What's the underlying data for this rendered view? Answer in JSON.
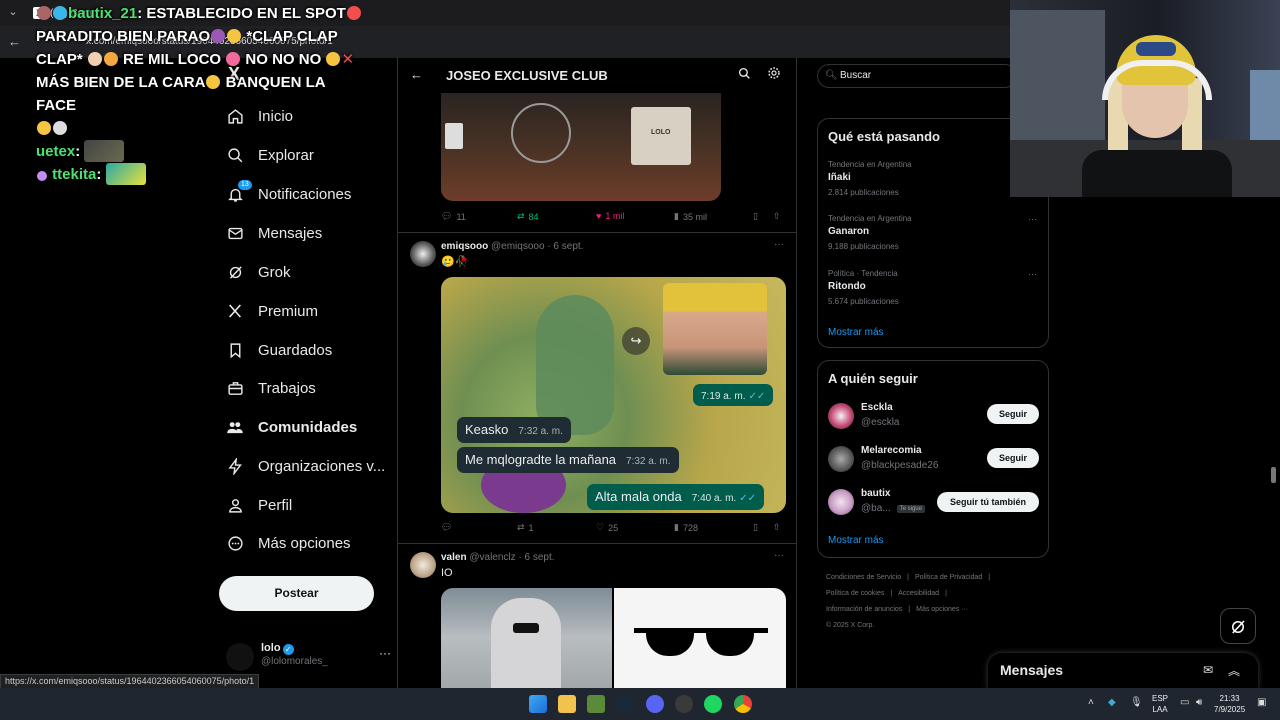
{
  "browser": {
    "tab_title": "(13) Com",
    "url": "x.com/emiqsooo/status/1964402366054060075/photo/1",
    "status_url": "https://x.com/emiqsooo/status/1964402366054060075/photo/1"
  },
  "chat": {
    "messages": [
      {
        "user": "bautix_21",
        "text": ": ESTABLECIDO EN EL SPOT"
      },
      {
        "user": "",
        "text": "PARADITO BIEN PARAO"
      },
      {
        "user": "",
        "text": "*CLAP CLAP"
      },
      {
        "user": "",
        "text": "CLAP*"
      },
      {
        "user": "",
        "text": "RE MIL LOCO"
      },
      {
        "user": "",
        "text": "NO NO NO"
      },
      {
        "user": "",
        "text": "MÁS BIEN DE LA CARA"
      },
      {
        "user": "",
        "text": "BANQUEN LA FACE"
      },
      {
        "user": "uetex",
        "text": ":"
      },
      {
        "user": "ttekita",
        "text": ":"
      }
    ]
  },
  "sidebar": {
    "logo": "X",
    "items": [
      {
        "label": "Inicio",
        "icon": "home-icon"
      },
      {
        "label": "Explorar",
        "icon": "search-icon"
      },
      {
        "label": "Notificaciones",
        "icon": "bell-icon",
        "badge": "13"
      },
      {
        "label": "Mensajes",
        "icon": "mail-icon"
      },
      {
        "label": "Grok",
        "icon": "grok-icon"
      },
      {
        "label": "Premium",
        "icon": "x-logo-icon"
      },
      {
        "label": "Guardados",
        "icon": "bookmark-icon"
      },
      {
        "label": "Trabajos",
        "icon": "briefcase-icon"
      },
      {
        "label": "Comunidades",
        "icon": "people-icon"
      },
      {
        "label": "Organizaciones v...",
        "icon": "lightning-icon"
      },
      {
        "label": "Perfil",
        "icon": "person-icon"
      },
      {
        "label": "Más opciones",
        "icon": "more-circle-icon"
      }
    ],
    "post_button": "Postear",
    "account": {
      "name": "lolo",
      "handle": "@lolomorales_",
      "more": "···"
    }
  },
  "main": {
    "header_title": "JOSEO EXCLUSIVE CLUB",
    "tweet1": {
      "image_caption": "LOLO",
      "replies": "11",
      "retweets": "84",
      "likes": "1 mil",
      "views": "35 mil"
    },
    "tweet2": {
      "name": "emiqsooo",
      "handle": "@emiqsooo",
      "date": "· 6 sept.",
      "text": "🥲🥀",
      "chat": [
        {
          "dir": "out",
          "text": "",
          "time": "7:19 a. m."
        },
        {
          "dir": "in",
          "text": "Keasko",
          "time": "7:32 a. m."
        },
        {
          "dir": "in",
          "text": "Me mqlogradte la mañana",
          "time": "7:32 a. m."
        },
        {
          "dir": "out",
          "text": "Alta mala onda",
          "time": "7:40 a. m."
        }
      ],
      "replies": "",
      "retweets": "1",
      "likes": "25",
      "views": "728"
    },
    "tweet3": {
      "name": "valen",
      "handle": "@valenclz",
      "date": "· 6 sept.",
      "text": "IO"
    }
  },
  "right": {
    "search_placeholder": "Buscar",
    "trends_title": "Qué está pasando",
    "trends": [
      {
        "category": "Tendencia en Argentina",
        "name": "Iñaki",
        "count": "2.814 publicaciones"
      },
      {
        "category": "Tendencia en Argentina",
        "name": "Ganaron",
        "count": "9.188 publicaciones"
      },
      {
        "category": "Política · Tendencia",
        "name": "Ritondo",
        "count": "5.674 publicaciones"
      }
    ],
    "show_more": "Mostrar más",
    "follow_title": "A quién seguir",
    "follow": [
      {
        "name": "Esckla",
        "handle": "@esckla",
        "button": "Seguir",
        "follows_you": ""
      },
      {
        "name": "Melarecomia",
        "handle": "@blackpesade26",
        "button": "Seguir",
        "follows_you": ""
      },
      {
        "name": "bautix",
        "handle": "@ba...",
        "button": "Seguir tú también",
        "follows_you": "Te sigue"
      }
    ],
    "follow_show_more": "Mostrar más",
    "footer": [
      "Condiciones de Servicio",
      "|",
      "Política de Privacidad",
      "|",
      "Política de cookies",
      "|",
      "Accesibilidad",
      "|",
      "Información de anuncios",
      "|",
      "Más opciones ···",
      "© 2025 X Corp."
    ]
  },
  "messages_drawer": {
    "title": "Mensajes"
  },
  "taskbar": {
    "lang1": "ESP",
    "lang2": "LAA",
    "time": "21:33",
    "date": "7/9/2025"
  },
  "colors": {
    "accent": "#1d9bf0",
    "retweet": "#00ba7c",
    "like": "#f91880",
    "whatsapp_out": "#005c4b",
    "whatsapp_in": "#202c33"
  }
}
